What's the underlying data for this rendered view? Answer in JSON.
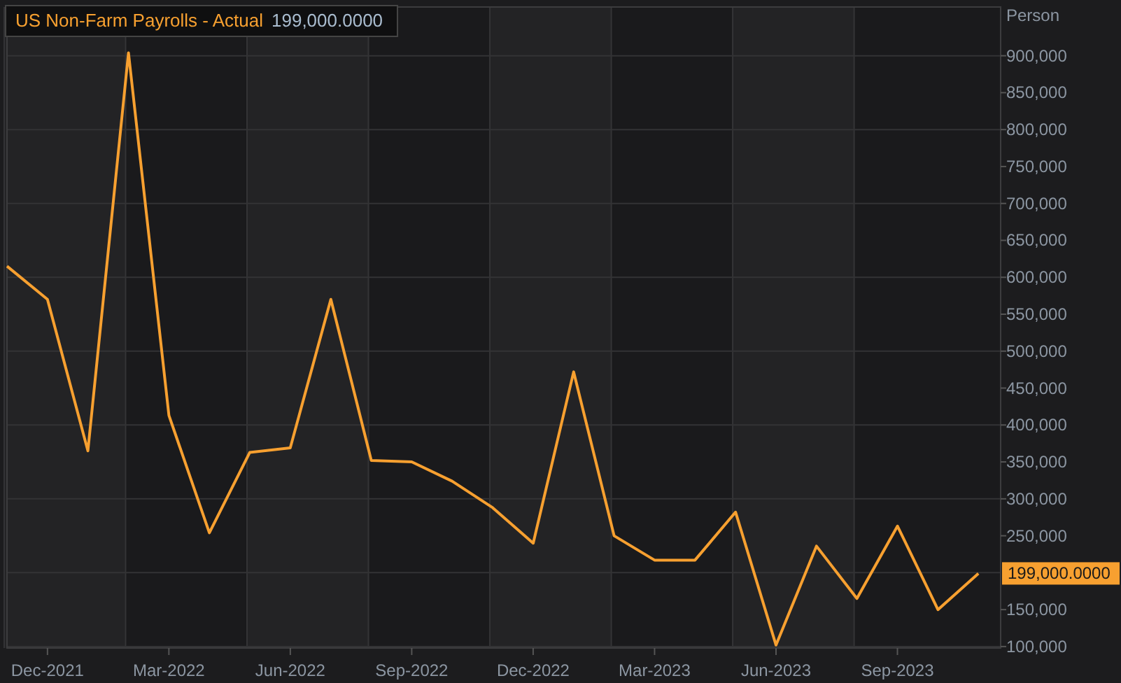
{
  "legend": {
    "value": "199,000.0000"
  },
  "last_value_label": "199,000.0000",
  "chart_data": {
    "type": "line",
    "ylabel": "Person",
    "grid": true,
    "categories": [
      null,
      "Dec-2021",
      null,
      null,
      "Mar-2022",
      null,
      null,
      "Jun-2022",
      null,
      null,
      "Sep-2022",
      null,
      null,
      "Dec-2022",
      null,
      null,
      "Mar-2023",
      null,
      null,
      "Jun-2023",
      null,
      null,
      "Sep-2023",
      null,
      null
    ],
    "series": [
      {
        "name": "US Non-Farm Payrolls - Actual",
        "color": "#f7a030",
        "values": [
          615000,
          570000,
          365000,
          904000,
          413000,
          254000,
          363000,
          369000,
          570000,
          352000,
          350000,
          324000,
          288000,
          240000,
          472000,
          250000,
          217000,
          217000,
          282000,
          102000,
          236000,
          165000,
          263000,
          150000,
          199000
        ]
      }
    ],
    "ylim": [
      98000,
      966000
    ],
    "yticks": [
      {
        "value": 100000,
        "label": "100,000"
      },
      {
        "value": 150000,
        "label": "150,000"
      },
      {
        "value": 250000,
        "label": "250,000"
      },
      {
        "value": 300000,
        "label": "300,000"
      },
      {
        "value": 350000,
        "label": "350,000"
      },
      {
        "value": 400000,
        "label": "400,000"
      },
      {
        "value": 450000,
        "label": "450,000"
      },
      {
        "value": 500000,
        "label": "500,000"
      },
      {
        "value": 550000,
        "label": "550,000"
      },
      {
        "value": 600000,
        "label": "600,000"
      },
      {
        "value": 650000,
        "label": "650,000"
      },
      {
        "value": 700000,
        "label": "700,000"
      },
      {
        "value": 750000,
        "label": "750,000"
      },
      {
        "value": 800000,
        "label": "800,000"
      },
      {
        "value": 850000,
        "label": "850,000"
      },
      {
        "value": 900000,
        "label": "900,000"
      }
    ]
  }
}
